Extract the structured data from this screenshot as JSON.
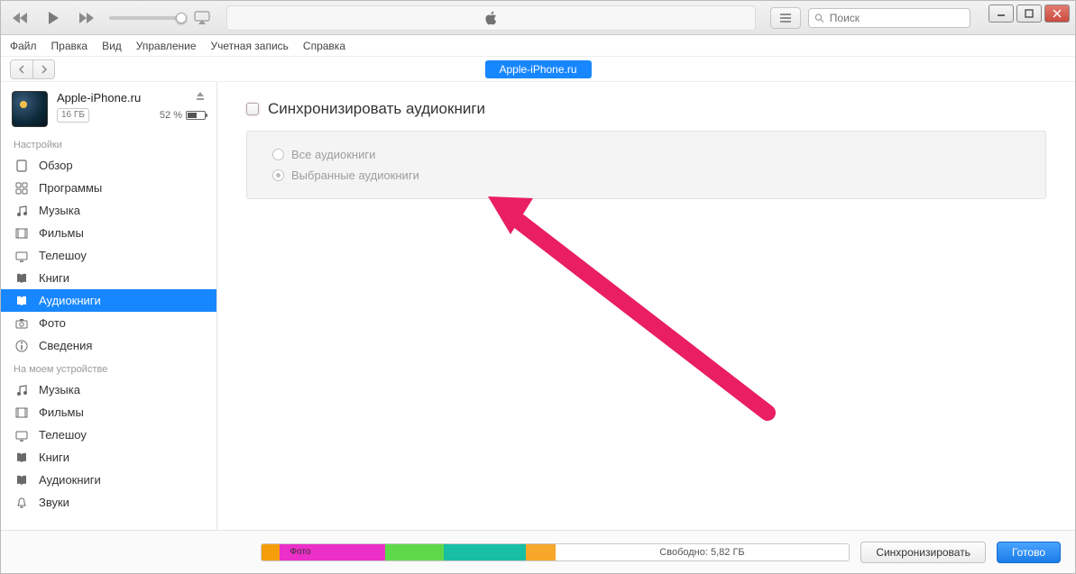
{
  "menubar": {
    "items": [
      "Файл",
      "Правка",
      "Вид",
      "Управление",
      "Учетная запись",
      "Справка"
    ]
  },
  "search": {
    "placeholder": "Поиск"
  },
  "tab": {
    "label": "Apple-iPhone.ru"
  },
  "device": {
    "name": "Apple-iPhone.ru",
    "capacity": "16 ГБ",
    "battery_pct": "52 %"
  },
  "sidebar": {
    "section_settings": "Настройки",
    "section_ondevice": "На моем устройстве",
    "settings": [
      {
        "label": "Обзор"
      },
      {
        "label": "Программы"
      },
      {
        "label": "Музыка"
      },
      {
        "label": "Фильмы"
      },
      {
        "label": "Телешоу"
      },
      {
        "label": "Книги"
      },
      {
        "label": "Аудиокниги"
      },
      {
        "label": "Фото"
      },
      {
        "label": "Сведения"
      }
    ],
    "ondevice": [
      {
        "label": "Музыка"
      },
      {
        "label": "Фильмы"
      },
      {
        "label": "Телешоу"
      },
      {
        "label": "Книги"
      },
      {
        "label": "Аудиокниги"
      },
      {
        "label": "Звуки"
      }
    ]
  },
  "content": {
    "sync_title": "Синхронизировать аудиокниги",
    "radio_all": "Все аудиокниги",
    "radio_selected": "Выбранные аудиокниги"
  },
  "footer": {
    "photo_label": "Фото",
    "free_text": "Свободно: 5,82 ГБ",
    "sync_btn": "Синхронизировать",
    "done_btn": "Готово",
    "segments": [
      {
        "color": "#f59e0b",
        "width": "3%"
      },
      {
        "color": "#ec2fc8",
        "width": "18%"
      },
      {
        "color": "#5fd94a",
        "width": "10%"
      },
      {
        "color": "#19bfa4",
        "width": "14%"
      },
      {
        "color": "#f7a72a",
        "width": "5%"
      }
    ]
  }
}
